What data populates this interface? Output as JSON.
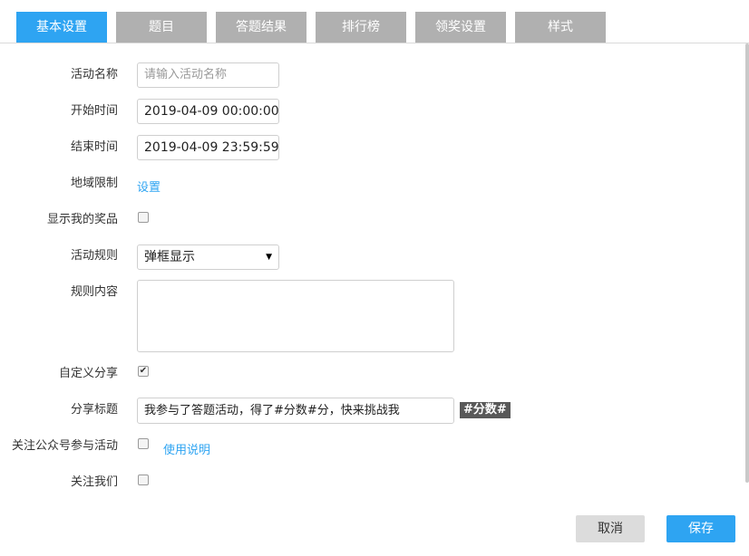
{
  "tabs": [
    {
      "label": "基本设置",
      "active": true
    },
    {
      "label": "题目",
      "active": false
    },
    {
      "label": "答题结果",
      "active": false
    },
    {
      "label": "排行榜",
      "active": false
    },
    {
      "label": "领奖设置",
      "active": false
    },
    {
      "label": "样式",
      "active": false
    }
  ],
  "form": {
    "activity_name": {
      "label": "活动名称",
      "placeholder": "请输入活动名称",
      "value": ""
    },
    "start_time": {
      "label": "开始时间",
      "value": "2019-04-09 00:00:00"
    },
    "end_time": {
      "label": "结束时间",
      "value": "2019-04-09 23:59:59"
    },
    "region_limit": {
      "label": "地域限制",
      "link": "设置"
    },
    "show_prizes": {
      "label": "显示我的奖品",
      "checked": false
    },
    "activity_rules": {
      "label": "活动规则",
      "selected": "弹框显示"
    },
    "rules_content": {
      "label": "规则内容",
      "value": ""
    },
    "custom_share": {
      "label": "自定义分享",
      "checked": true
    },
    "share_title": {
      "label": "分享标题",
      "value": "我参与了答题活动，得了#分数#分，快来挑战我",
      "tag": "#分数#"
    },
    "follow_official": {
      "label": "关注公众号参与活动",
      "checked": false,
      "link": "使用说明"
    },
    "follow_us": {
      "label": "关注我们",
      "checked": false
    }
  },
  "buttons": {
    "cancel": "取消",
    "save": "保存"
  },
  "colors": {
    "accent": "#2ea4f2",
    "tab_inactive": "#b0b0b0"
  },
  "icons": {
    "select_arrow": "▼",
    "check": "✔"
  }
}
